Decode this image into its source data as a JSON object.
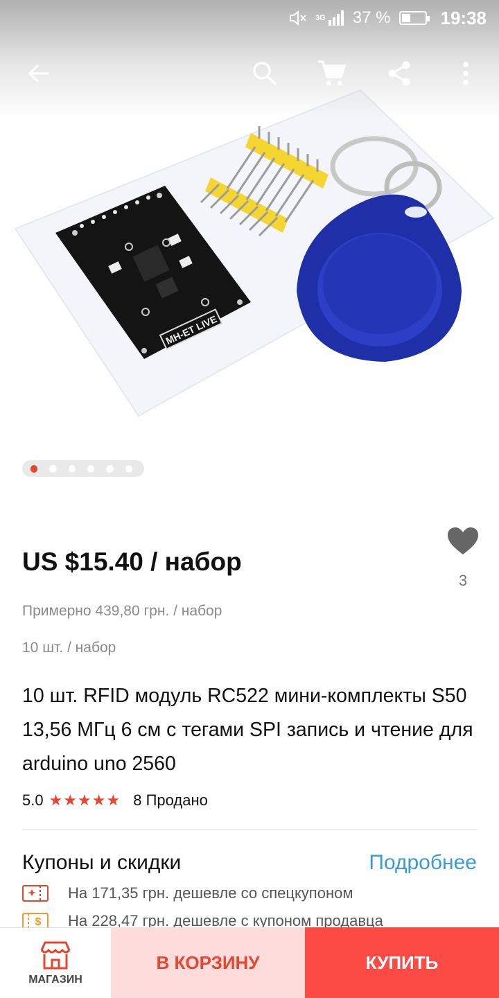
{
  "status_bar": {
    "network": "3G",
    "battery": "37 %",
    "battery_level": 0.37,
    "time": "19:38"
  },
  "toolbar": {
    "icons": [
      "back-arrow-icon",
      "search-icon",
      "cart-icon",
      "share-icon",
      "more-vertical-icon"
    ]
  },
  "gallery": {
    "image_count": 6,
    "active_index": 0,
    "pcb_label": "MH-ET LIVE"
  },
  "product": {
    "price": "US $15.40 / набор",
    "wishlist_count": "3",
    "approx_price": "Примерно 439,80 грн. / набор",
    "unit": "10 шт. / набор",
    "title": "10 шт. RFID модуль RC522 мини-комплекты S50 13,56 МГц 6 см с тегами SPI запись и чтение для arduino uno 2560",
    "rating": "5.0",
    "stars": "★★★★★",
    "sold": "8 Продано"
  },
  "coupons": {
    "title": "Купоны и скидки",
    "more_label": "Подробнее",
    "items": [
      "На 171,35 грн. дешевле со спецкупоном",
      "На 228,47 грн. дешевле с купоном продавца"
    ]
  },
  "bottom_bar": {
    "shop_label": "МАГАЗИН",
    "add_to_cart_label": "В КОРЗИНУ",
    "buy_label": "КУПИТЬ"
  },
  "colors": {
    "accent_red": "#e8452f",
    "buy_red": "#fc4a44",
    "cart_pink": "#fedcdb",
    "link_blue": "#3a9bd0"
  }
}
